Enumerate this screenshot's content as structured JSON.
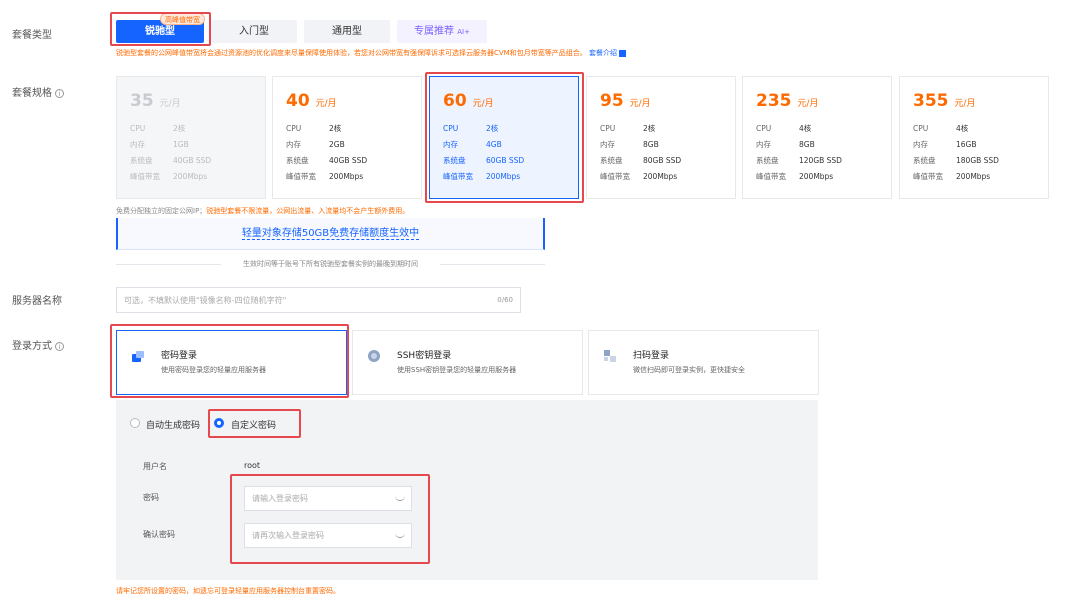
{
  "package_type": {
    "label": "套餐类型",
    "tabs": [
      {
        "label": "锐驰型",
        "tag": "高峰值带宽"
      },
      {
        "label": "入门型"
      },
      {
        "label": "通用型"
      },
      {
        "label": "专属推荐",
        "suffix": "AI+"
      }
    ],
    "note": "锐驰型套餐的公网峰值带宽将会通过资源池的优化调度来尽量保障使用体验，若您对公网带宽有强保障诉求可选择云服务器CVM和包月带宽等产品组合。",
    "note_link": "套餐介绍"
  },
  "package_spec": {
    "label": "套餐规格",
    "unit": "元/月",
    "keys": {
      "cpu": "CPU",
      "mem": "内存",
      "disk": "系统盘",
      "bw": "峰值带宽"
    },
    "cards": [
      {
        "price": "35",
        "cpu": "2核",
        "mem": "1GB",
        "disk": "40GB SSD",
        "bw": "200Mbps",
        "state": "disabled"
      },
      {
        "price": "40",
        "cpu": "2核",
        "mem": "2GB",
        "disk": "40GB SSD",
        "bw": "200Mbps",
        "state": "normal"
      },
      {
        "price": "60",
        "cpu": "2核",
        "mem": "4GB",
        "disk": "60GB SSD",
        "bw": "200Mbps",
        "state": "selected"
      },
      {
        "price": "95",
        "cpu": "2核",
        "mem": "8GB",
        "disk": "80GB SSD",
        "bw": "200Mbps",
        "state": "normal"
      },
      {
        "price": "235",
        "cpu": "4核",
        "mem": "8GB",
        "disk": "120GB SSD",
        "bw": "200Mbps",
        "state": "normal"
      },
      {
        "price": "355",
        "cpu": "4核",
        "mem": "16GB",
        "disk": "180GB SSD",
        "bw": "200Mbps",
        "state": "normal"
      }
    ],
    "ip_note_prefix": "免费分配独立的固定公网IP；",
    "ip_note_highlight": "锐驰型套餐不限流量，公网出流量、入流量均不会产生额外费用。",
    "storage_banner": "轻量对象存储50GB免费存储额度生效中",
    "expire_note": "生效时间等于账号下所有锐驰型套餐实例的最晚到期时间"
  },
  "server_name": {
    "label": "服务器名称",
    "placeholder": "可选，不填默认使用\"镜像名称-四位随机字符\"",
    "counter": "0/60"
  },
  "login": {
    "label": "登录方式",
    "methods": [
      {
        "title": "密码登录",
        "desc": "使用密码登录您的轻量应用服务器"
      },
      {
        "title": "SSH密钥登录",
        "desc": "使用SSH密钥登录您的轻量应用服务器"
      },
      {
        "title": "扫码登录",
        "desc": "微信扫码即可登录实例，更快捷安全"
      }
    ],
    "auto_password": "自动生成密码",
    "custom_password": "自定义密码",
    "username_label": "用户名",
    "username_value": "root",
    "password_label": "密码",
    "password_placeholder": "请输入登录密码",
    "confirm_label": "确认密码",
    "confirm_placeholder": "请再次输入登录密码",
    "warning": "请牢记您所设置的密码，如遗忘可登录轻量应用服务器控制台重置密码。"
  }
}
